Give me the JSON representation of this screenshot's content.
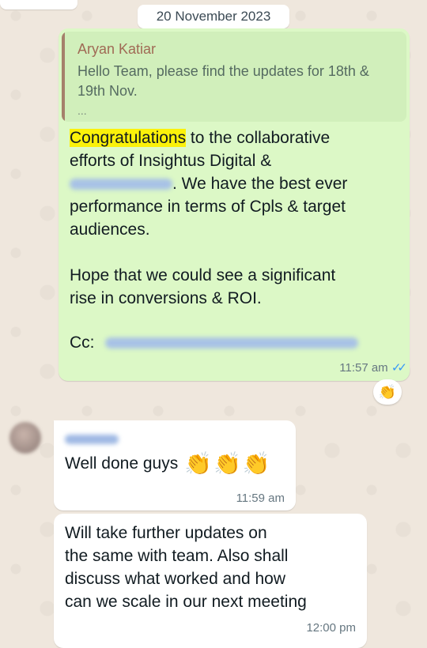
{
  "date_label": "20 November 2023",
  "outgoing_message": {
    "quote": {
      "author": "Aryan Katiar",
      "text": "Hello Team, please find the updates for 18th & 19th Nov.",
      "ellipsis": "..."
    },
    "highlighted_word": "Congratulations",
    "line1_rest": " to the collaborative",
    "line2": "efforts of Insightus Digital &",
    "line3_rest": ". We have the best ever",
    "line4": "performance in terms of Cpls & target",
    "line5": "audiences.",
    "line6": "Hope that we could see a significant",
    "line7": "rise in conversions & ROI.",
    "cc_label": "Cc:",
    "time": "11:57 am",
    "ticks": "✓✓",
    "reaction_emoji": "👏"
  },
  "incoming_message_1": {
    "text": "Well done guys",
    "emojis": "👏👏👏",
    "time": "11:59 am"
  },
  "incoming_message_2": {
    "line1": "Will take further updates on",
    "line2": "the same with team. Also shall",
    "line3": "discuss what worked and how",
    "line4": "can we scale in our next meeting",
    "time": "12:00 pm"
  }
}
